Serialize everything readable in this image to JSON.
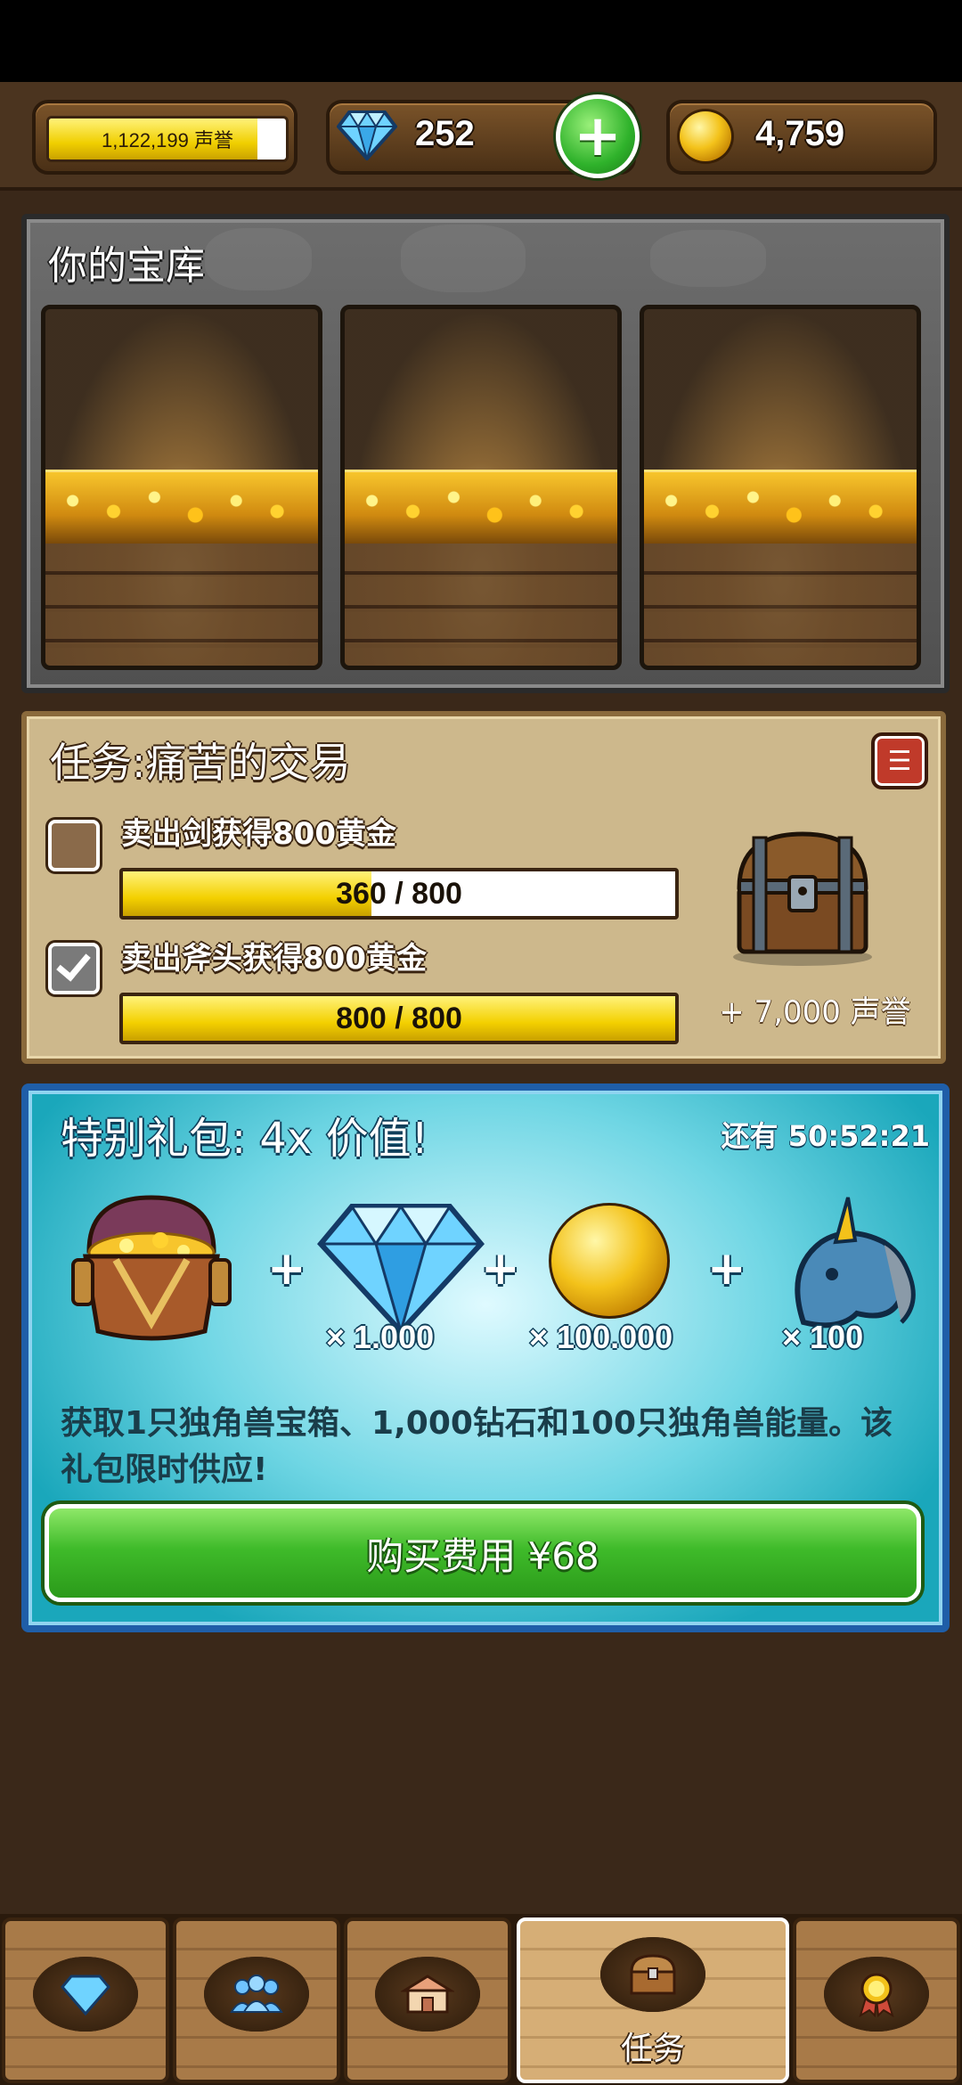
{
  "hud": {
    "fame_text": "1,122,199 声誉",
    "fame_fill_pct": 88,
    "gems": "252",
    "gold": "4,759"
  },
  "vault": {
    "title": "你的宝库"
  },
  "quest": {
    "title": "任务:痛苦的交易",
    "tasks": [
      {
        "label": "卖出剑获得800黄金",
        "progress_text": "360 / 800",
        "current": 360,
        "target": 800,
        "done": false
      },
      {
        "label": "卖出斧头获得800黄金",
        "progress_text": "800 / 800",
        "current": 800,
        "target": 800,
        "done": true
      }
    ],
    "reward": "+ 7,000 声誉"
  },
  "offer": {
    "title": "特别礼包:  4x 价值!",
    "timer": "还有 50:52:21",
    "items": [
      {
        "icon": "treasure-chest-icon",
        "qty": ""
      },
      {
        "icon": "diamond-icon",
        "qty": "× 1.000"
      },
      {
        "icon": "gold-coin-icon",
        "qty": "× 100.000"
      },
      {
        "icon": "unicorn-icon",
        "qty": "× 100"
      }
    ],
    "plus": "+",
    "description": "获取1只独角兽宝箱、1,000钻石和100只独角兽能量。该礼包限时供应!",
    "buy_label": "购买费用 ¥68"
  },
  "nav": {
    "items": [
      {
        "icon": "diamond-icon",
        "label": ""
      },
      {
        "icon": "people-icon",
        "label": ""
      },
      {
        "icon": "shop-icon",
        "label": ""
      },
      {
        "icon": "chest-icon",
        "label": "任务",
        "active": true
      },
      {
        "icon": "medal-icon",
        "label": ""
      }
    ]
  },
  "colors": {
    "background": "#3a2819",
    "offer_border": "#1f5ea8",
    "buy_green": "#3fbb2a",
    "bar_yellow": "#f3d000"
  }
}
